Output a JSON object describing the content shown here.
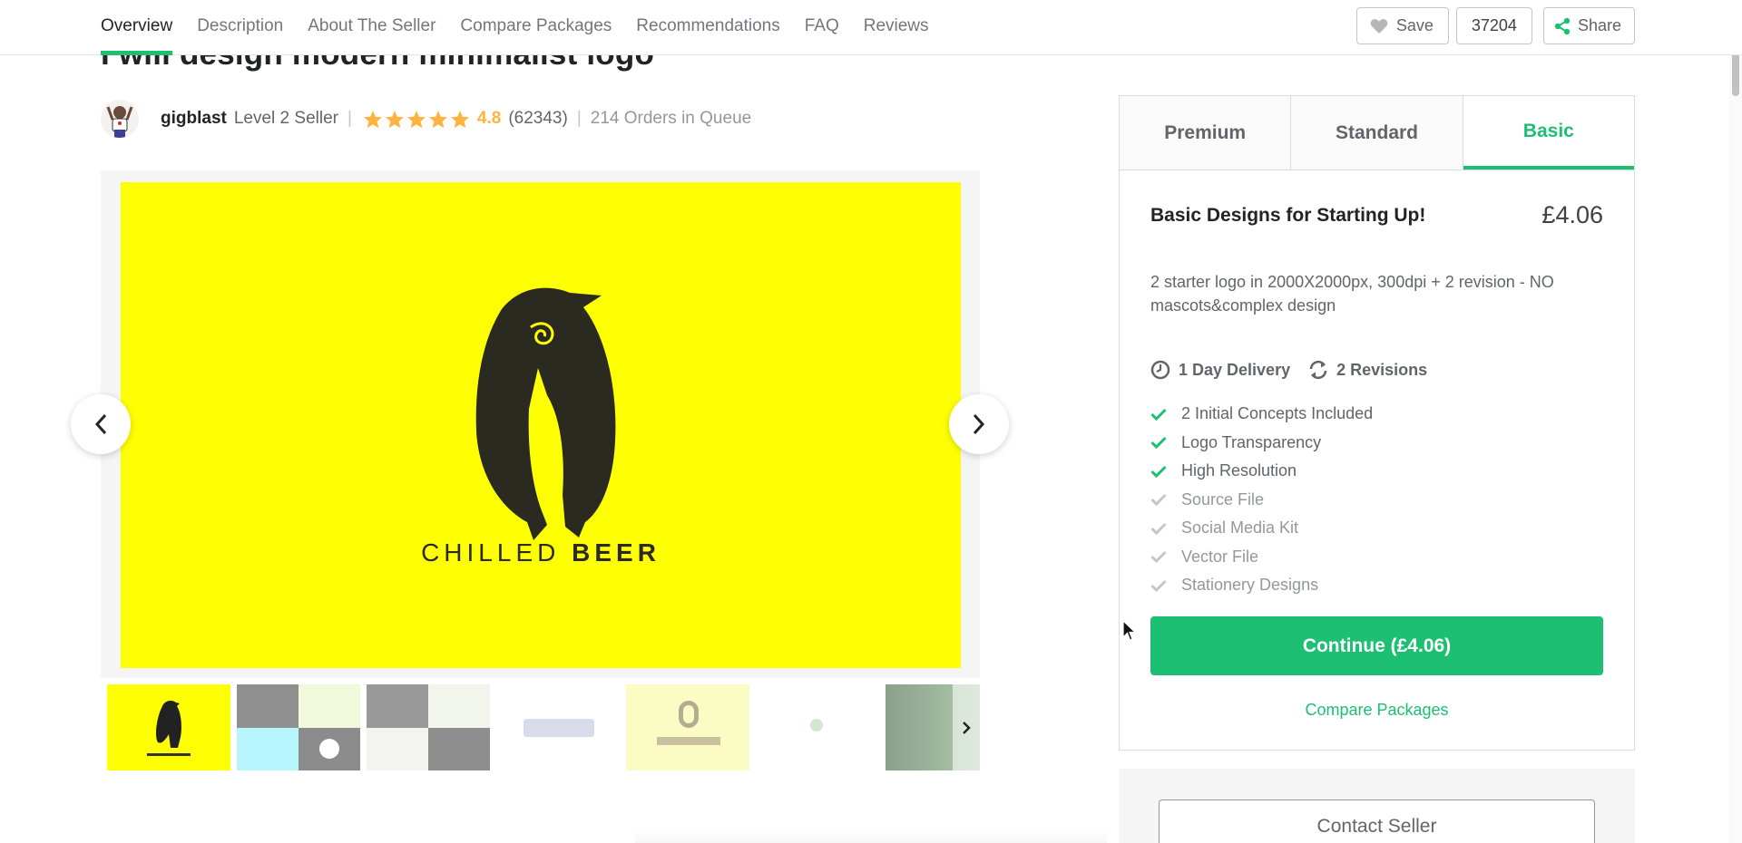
{
  "nav": {
    "tabs": [
      "Overview",
      "Description",
      "About The Seller",
      "Compare Packages",
      "Recommendations",
      "FAQ",
      "Reviews"
    ],
    "active_tab": "Overview",
    "save_label": "Save",
    "save_count": "37204",
    "share_label": "Share"
  },
  "gig": {
    "title": "I will design modern minimalist logo"
  },
  "seller": {
    "name": "gigblast",
    "level": "Level 2 Seller",
    "rating": "4.8",
    "reviews": "(62343)",
    "queue": "214 Orders in Queue",
    "star_color": "#ffb33e"
  },
  "gallery": {
    "slide_brand_light": "CHILLED",
    "slide_brand_bold": "BEER",
    "slide_bg": "#ffff03",
    "thumb_count": 7
  },
  "package": {
    "tabs": [
      "Premium",
      "Standard",
      "Basic"
    ],
    "active_tab": "Basic",
    "name": "Basic Designs for Starting Up!",
    "price": "£4.06",
    "description": "2 starter logo in 2000X2000px, 300dpi + 2 revision - NO mascots&complex design",
    "delivery": "1 Day Delivery",
    "revisions": "2 Revisions",
    "features": [
      {
        "label": "2 Initial Concepts Included",
        "included": true
      },
      {
        "label": "Logo Transparency",
        "included": true
      },
      {
        "label": "High Resolution",
        "included": true
      },
      {
        "label": "Source File",
        "included": false
      },
      {
        "label": "Social Media Kit",
        "included": false
      },
      {
        "label": "Vector File",
        "included": false
      },
      {
        "label": "Stationery Designs",
        "included": false
      }
    ],
    "continue_label": "Continue (£4.06)",
    "compare_label": "Compare Packages",
    "accent": "#1dbf73"
  },
  "contact": {
    "label": "Contact Seller"
  }
}
